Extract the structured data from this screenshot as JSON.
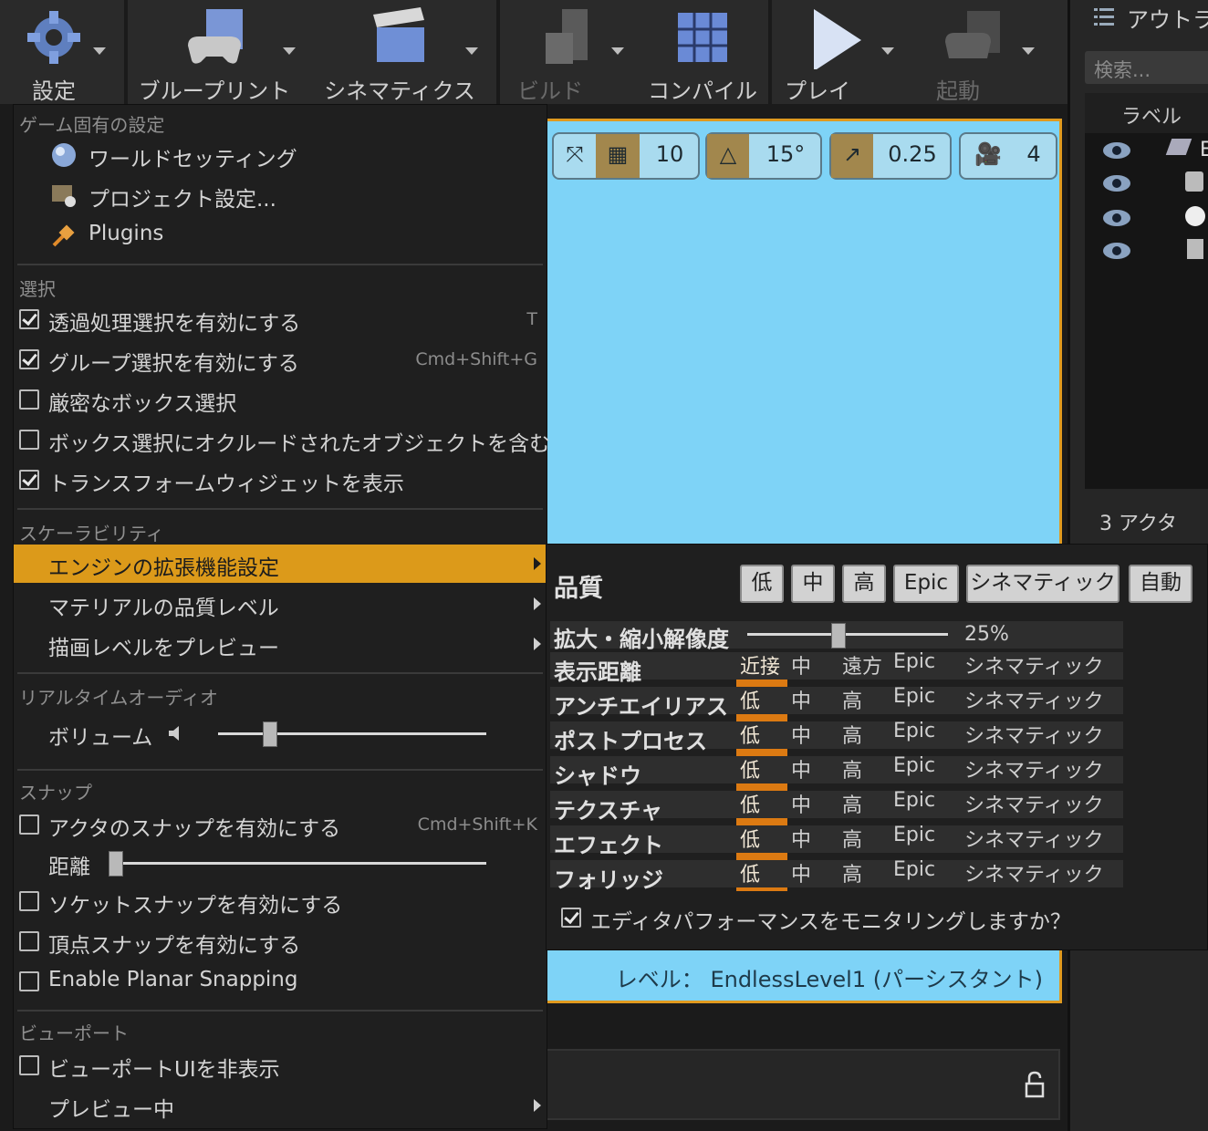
{
  "toolbar": {
    "buttons": [
      {
        "label": "設定"
      },
      {
        "label": "ブループリント"
      },
      {
        "label": "シネマティクス"
      },
      {
        "label": "ビルド"
      },
      {
        "label": "コンパイル"
      },
      {
        "label": "プレイ"
      },
      {
        "label": "起動"
      }
    ]
  },
  "outliner": {
    "title": "アウトライ",
    "search_placeholder": "検索...",
    "column_label": "ラベル",
    "first_item": "En",
    "count": "3 アクタ"
  },
  "viewport": {
    "grid_value": "10",
    "rotation_value": "15°",
    "scale_value": "0.25",
    "camera_speed": "4",
    "level_label": "レベル： EndlessLevel1 (パーシスタント)"
  },
  "menu": {
    "game_section": "ゲーム固有の設定",
    "world_settings": "ワールドセッティング",
    "project_settings": "プロジェクト設定...",
    "plugins": "Plugins",
    "selection_section": "選択",
    "translucent_select": "透過処理選択を有効にする",
    "translucent_shortcut": "T",
    "group_select": "グループ選択を有効にする",
    "group_shortcut": "Cmd+Shift+G",
    "strict_box": "厳密なボックス選択",
    "occluded_box": "ボックス選択にオクルードされたオブジェクトを含む",
    "transform_widget": "トランスフォームウィジェットを表示",
    "scalability_section": "スケーラビリティ",
    "engine_scalability": "エンジンの拡張機能設定",
    "material_quality": "マテリアルの品質レベル",
    "preview_rendering": "描画レベルをプレビュー",
    "audio_section": "リアルタイムオーディオ",
    "volume": "ボリューム",
    "snap_section": "スナップ",
    "actor_snap": "アクタのスナップを有効にする",
    "actor_snap_shortcut": "Cmd+Shift+K",
    "distance": "距離",
    "socket_snap": "ソケットスナップを有効にする",
    "vertex_snap": "頂点スナップを有効にする",
    "planar_snap": "Enable Planar Snapping",
    "viewport_section": "ビューポート",
    "hide_ui": "ビューポートUIを非表示",
    "previewing": "プレビュー中",
    "checks": {
      "translucent": true,
      "group": true,
      "strict": false,
      "occluded": false,
      "transform": true,
      "actor_snap": false,
      "socket": false,
      "vertex": false,
      "planar": false,
      "hide_ui": false
    },
    "volume_level": 0.19,
    "distance_level": 0.0
  },
  "quality": {
    "title": "品質",
    "presets": [
      "低",
      "中",
      "高",
      "Epic",
      "シネマティック",
      "自動"
    ],
    "resolution_label": "拡大・縮小解像度",
    "resolution_value": "25%",
    "resolution_level": 0.45,
    "rows": [
      {
        "label": "表示距離",
        "options": [
          "近接",
          "中",
          "遠方",
          "Epic",
          "シネマティック"
        ]
      },
      {
        "label": "アンチエイリアス",
        "options": [
          "低",
          "中",
          "高",
          "Epic",
          "シネマティック"
        ]
      },
      {
        "label": "ポストプロセス",
        "options": [
          "低",
          "中",
          "高",
          "Epic",
          "シネマティック"
        ]
      },
      {
        "label": "シャドウ",
        "options": [
          "低",
          "中",
          "高",
          "Epic",
          "シネマティック"
        ]
      },
      {
        "label": "テクスチャ",
        "options": [
          "低",
          "中",
          "高",
          "Epic",
          "シネマティック"
        ]
      },
      {
        "label": "エフェクト",
        "options": [
          "低",
          "中",
          "高",
          "Epic",
          "シネマティック"
        ]
      },
      {
        "label": "フォリッジ",
        "options": [
          "低",
          "中",
          "高",
          "Epic",
          "シネマティック"
        ]
      }
    ],
    "monitor_label": "エディタパフォーマンスをモニタリングしますか？",
    "monitor_checked": true,
    "selected_color": "#dc7a12"
  }
}
